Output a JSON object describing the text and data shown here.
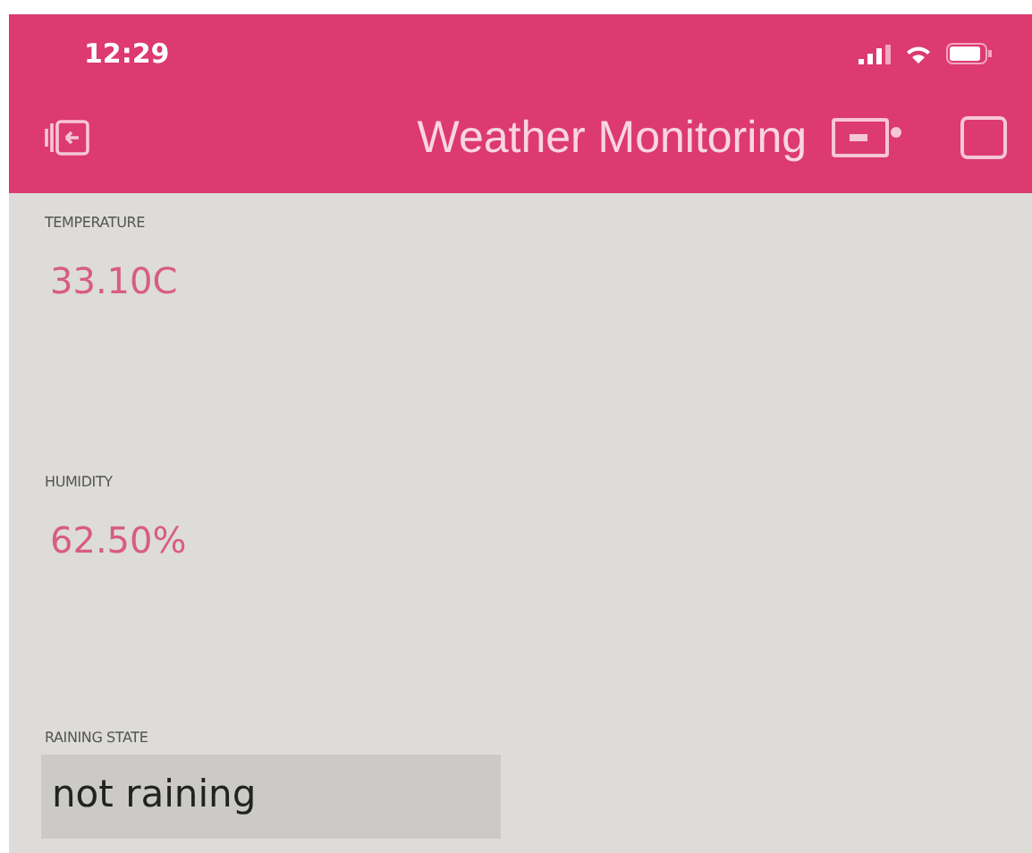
{
  "status_bar": {
    "time": "12:29"
  },
  "header": {
    "title": "Weather Monitoring"
  },
  "widgets": [
    {
      "kind": "value",
      "label": "TEMPERATURE",
      "value": "33.10C"
    },
    {
      "kind": "value",
      "label": "HUMIDITY",
      "value": "62.50%"
    },
    {
      "kind": "display",
      "label": "RAINING STATE",
      "value": "not raining"
    }
  ]
}
